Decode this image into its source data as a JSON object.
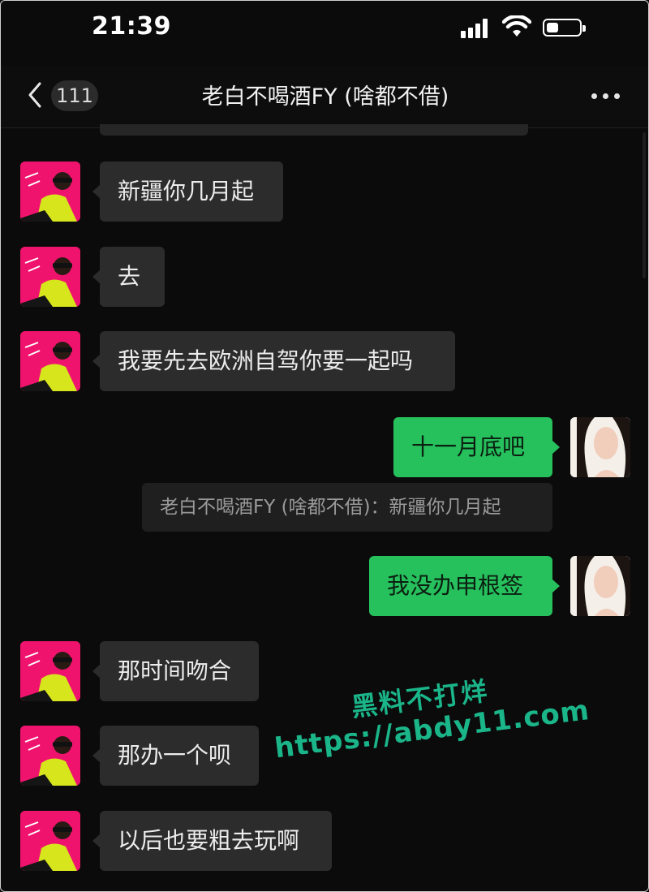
{
  "status_bar": {
    "time": "21:39"
  },
  "header": {
    "unread_count": "111",
    "title": "老白不喝酒FY (啥都不借)"
  },
  "messages": [
    {
      "side": "in",
      "text": "新疆你几月起"
    },
    {
      "side": "in",
      "text": "去"
    },
    {
      "side": "in",
      "text": "我要先去欧洲自驾你要一起吗"
    },
    {
      "side": "out",
      "text": "十一月底吧"
    },
    {
      "side": "quote",
      "text": "老白不喝酒FY (啥都不借)：新疆你几月起"
    },
    {
      "side": "out",
      "text": "我没办申根签"
    },
    {
      "side": "in",
      "text": "那时间吻合"
    },
    {
      "side": "in",
      "text": "那办一个呗"
    },
    {
      "side": "in",
      "text": "以后也要粗去玩啊"
    }
  ],
  "watermark": {
    "line1": "黑料不打烊",
    "line2": "https://abdy11.com"
  },
  "colors": {
    "background": "#0b0b0b",
    "incoming_bubble": "#2c2c2c",
    "outgoing_bubble": "#26c05d",
    "watermark": "#1bb58a"
  },
  "icons": {
    "back": "chevron-left-icon",
    "more": "more-dots-icon",
    "signal": "cellular-signal-icon",
    "wifi": "wifi-icon",
    "battery": "battery-icon"
  }
}
